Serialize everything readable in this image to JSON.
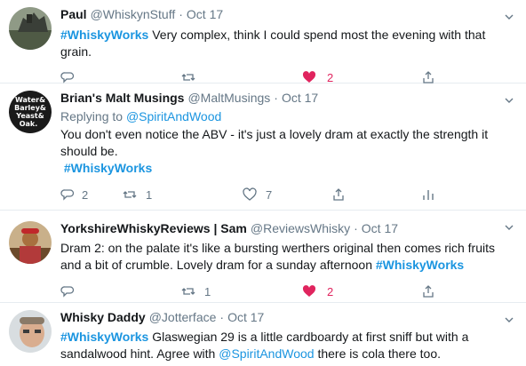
{
  "tweets": [
    {
      "name": "Paul",
      "handle": "@WhiskynStuff",
      "time": "Oct 17",
      "replying_to": "",
      "text_parts": [
        "#WhiskyWorks",
        " Very complex, think I could spend most the evening with that grain."
      ],
      "reply_count": "",
      "retweet_count": "",
      "like_count": "2",
      "liked": true,
      "has_analytics": false
    },
    {
      "name": "Brian's Malt Musings",
      "handle": "@MaltMusings",
      "time": "Oct 17",
      "replying_label": "Replying to",
      "replying_to": "@SpiritAndWood",
      "text_parts": [
        "You don't even notice the ABV - it's just a lovely dram at exactly the strength it should be.",
        "#WhiskyWorks"
      ],
      "avatar_text": [
        "Water&",
        "Barley&",
        "Yeast&",
        "Oak."
      ],
      "reply_count": "2",
      "retweet_count": "1",
      "like_count": "7",
      "liked": false,
      "has_analytics": true
    },
    {
      "name": "YorkshireWhiskyReviews | Sam",
      "handle": "@ReviewsWhisky",
      "time": "Oct 17",
      "replying_to": "",
      "text_parts": [
        "Dram 2: on the palate it's like a bursting werthers original then comes rich fruits and a bit of crumble. Lovely dram for a sunday afternoon ",
        "#WhiskyWorks"
      ],
      "reply_count": "",
      "retweet_count": "1",
      "like_count": "2",
      "liked": true,
      "has_analytics": false
    },
    {
      "name": "Whisky Daddy",
      "handle": "@Jotterface",
      "time": "Oct 17",
      "replying_to": "",
      "text_parts": [
        "#WhiskyWorks",
        " Glaswegian 29 is a little cardboardy at first sniff but with a sandalwood hint. Agree with ",
        "@SpiritAndWood",
        " there is cola there too."
      ],
      "reply_count": "",
      "retweet_count": "",
      "like_count": "",
      "liked": false,
      "has_analytics": false
    }
  ],
  "colors": {
    "link": "#1b95e0",
    "muted": "#657786",
    "like": "#e0245e",
    "divider": "#e6ecf0"
  },
  "icons": {
    "reply": "reply-icon",
    "retweet": "retweet-icon",
    "like": "heart-icon",
    "share": "share-icon",
    "analytics": "analytics-icon",
    "menu": "chevron-down-icon"
  }
}
